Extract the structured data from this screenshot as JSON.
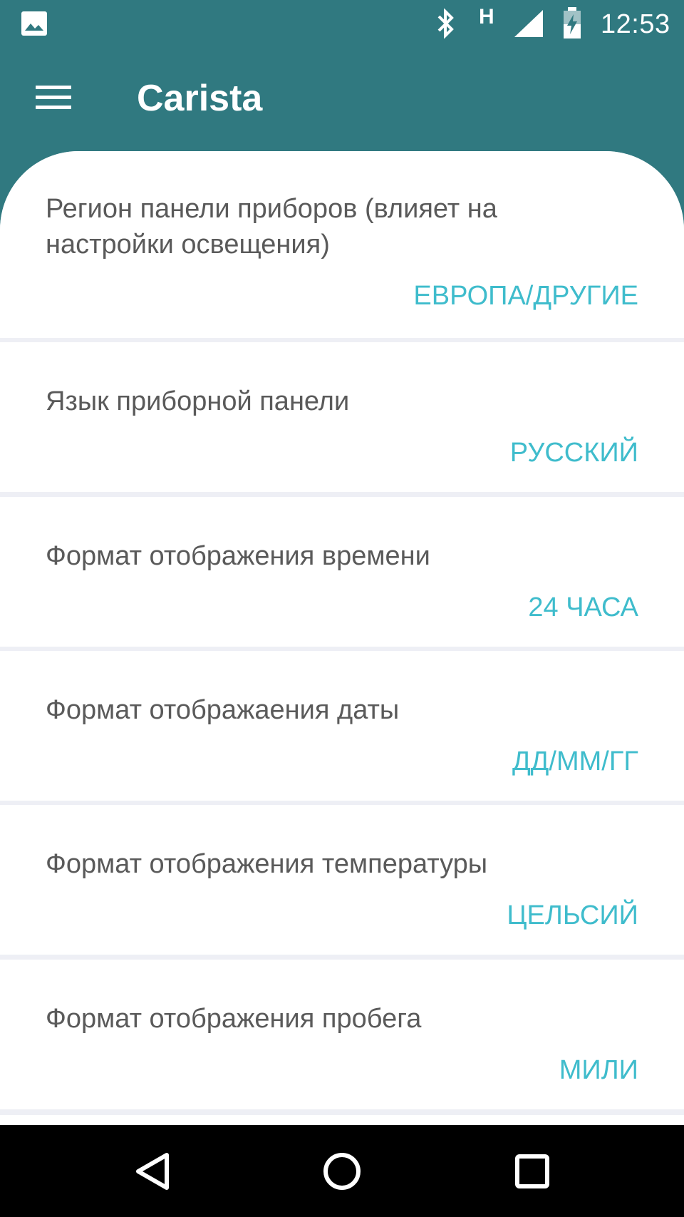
{
  "status_bar": {
    "network_label": "H",
    "time": "12:53"
  },
  "app_bar": {
    "title": "Carista"
  },
  "settings": [
    {
      "label": "Регион панели приборов (влияет на настройки освещения)",
      "value": "ЕВРОПА/ДРУГИЕ"
    },
    {
      "label": "Язык приборной панели",
      "value": "РУССКИЙ"
    },
    {
      "label": "Формат отображения времени",
      "value": "24 ЧАСА"
    },
    {
      "label": "Формат отображаения даты",
      "value": "ДД/ММ/ГГ"
    },
    {
      "label": "Формат отображения температуры",
      "value": "ЦЕЛЬСИЙ"
    },
    {
      "label": "Формат отображения пробега",
      "value": "МИЛИ"
    }
  ],
  "colors": {
    "primary": "#307980",
    "accent_value": "#3fbccc",
    "label_text": "#5a5a5a",
    "divider": "#eeeff5",
    "nav_bar": "#000000"
  },
  "icons": {
    "status": [
      "gallery-icon",
      "bluetooth-icon",
      "signal-icon",
      "battery-charging-icon"
    ],
    "nav": [
      "back-icon",
      "home-icon",
      "recents-icon"
    ]
  }
}
